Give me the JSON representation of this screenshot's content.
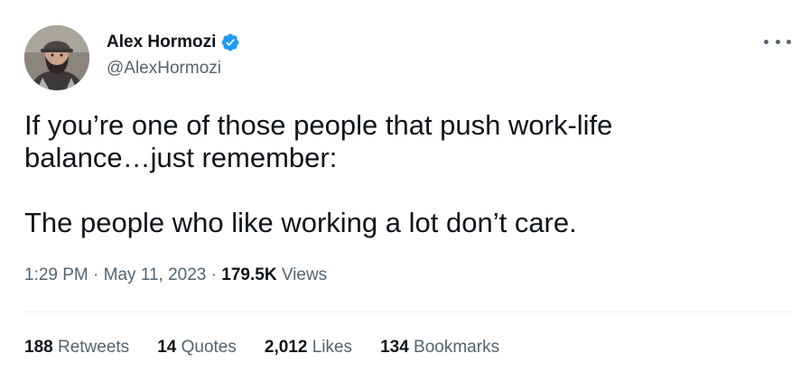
{
  "author": {
    "display_name": "Alex Hormozi",
    "handle": "@AlexHormozi",
    "verified": true,
    "avatar_icon": "avatar-photo"
  },
  "tweet": {
    "text": "If you’re one of those people that push work-life\nbalance…just remember:\n\nThe people who like working a lot don’t care.",
    "time": "1:29 PM",
    "date": "May 11, 2023",
    "separator": "·",
    "views_count": "179.5K",
    "views_label": "Views"
  },
  "stats": [
    {
      "count": "188",
      "label": "Retweets"
    },
    {
      "count": "14",
      "label": "Quotes"
    },
    {
      "count": "2,012",
      "label": "Likes"
    },
    {
      "count": "134",
      "label": "Bookmarks"
    }
  ],
  "colors": {
    "verified_badge": "#1d9bf0",
    "text_primary": "#0f1419",
    "text_secondary": "#536471",
    "divider": "#eff3f4"
  }
}
